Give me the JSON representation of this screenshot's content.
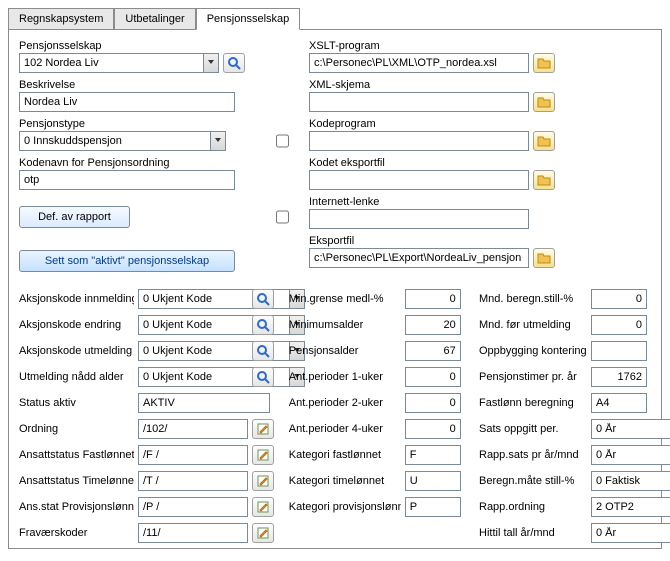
{
  "tabs": {
    "t0": "Regnskapsystem",
    "t1": "Utbetalinger",
    "t2": "Pensjonsselskap"
  },
  "left": {
    "pensjonsselskap_label": "Pensjonsselskap",
    "pensjonsselskap_value": "102 Nordea Liv",
    "beskrivelse_label": "Beskrivelse",
    "beskrivelse_value": "Nordea Liv",
    "pensjonstype_label": "Pensjonstype",
    "pensjonstype_value": "0 Innskuddspensjon",
    "kodenavn_label": "Kodenavn for Pensjonsordning",
    "kodenavn_value": "otp",
    "def_button": "Def. av rapport",
    "sett_button": "Sett som \"aktivt\" pensjonsselskap"
  },
  "right": {
    "xslt_label": "XSLT-program",
    "xslt_value": "c:\\Personec\\PL\\XML\\OTP_nordea.xsl",
    "xmlskjema_label": "XML-skjema",
    "xmlskjema_value": "",
    "kodeprogram_label": "Kodeprogram",
    "kodeprogram_value": "",
    "kodet_label": "Kodet eksportfil",
    "kodet_value": "",
    "internett_label": "Internett-lenke",
    "internett_value": "",
    "eksportfil_label": "Eksportfil",
    "eksportfil_value": "c:\\Personec\\PL\\Export\\NordeaLiv_pensjon"
  },
  "c1": {
    "r0l": "Aksjonskode innmelding",
    "r0v": "0 Ukjent Kode",
    "r1l": "Aksjonskode endring",
    "r1v": "0 Ukjent Kode",
    "r2l": "Aksjonskode utmelding",
    "r2v": "0 Ukjent Kode",
    "r3l": "Utmelding nådd alder",
    "r3v": "0 Ukjent Kode",
    "r4l": "Status aktiv",
    "r4v": "AKTIV",
    "r5l": "Ordning",
    "r5v": "/102/",
    "r6l": "Ansattstatus Fastlønnet",
    "r6v": "/F /",
    "r7l": "Ansattstatus Timelønnet",
    "r7v": "/T /",
    "r8l": "Ans.stat Provisjonslønnet",
    "r8v": "/P /",
    "r9l": "Fraværskoder",
    "r9v": "/11/"
  },
  "c2": {
    "r0l": "Min.grense medl-%",
    "r0v": "0",
    "r1l": "Minimumsalder",
    "r1v": "20",
    "r2l": "Pensjonsalder",
    "r2v": "67",
    "r3l": "Ant.perioder 1-uker",
    "r3v": "0",
    "r4l": "Ant.perioder 2-uker",
    "r4v": "0",
    "r5l": "Ant.perioder 4-uker",
    "r5v": "0",
    "r6l": "Kategori fastlønnet",
    "r6v": "F",
    "r7l": "Kategori timelønnet",
    "r7v": "U",
    "r8l": "Kategori provisjonslønnet",
    "r8v": "P"
  },
  "c3": {
    "r0l": "Mnd. beregn.still-%",
    "r0v": "0",
    "r1l": "Mnd. før utmelding",
    "r1v": "0",
    "r2l": "Oppbygging kontering",
    "r2v": "",
    "r3l": "Pensjonstimer pr. år",
    "r3v": "1762",
    "r4l": "Fastlønn beregning",
    "r4v": "A4",
    "r5l": "Sats oppgitt per.",
    "r5v": "0 År",
    "r6l": "Rapp.sats pr år/mnd",
    "r6v": "0 År",
    "r7l": "Beregn.måte still-%",
    "r7v": "0 Faktisk",
    "r8l": "Rapp.ordning",
    "r8v": "2 OTP2",
    "r9l": "Hittil tall år/mnd",
    "r9v": "0 År"
  }
}
